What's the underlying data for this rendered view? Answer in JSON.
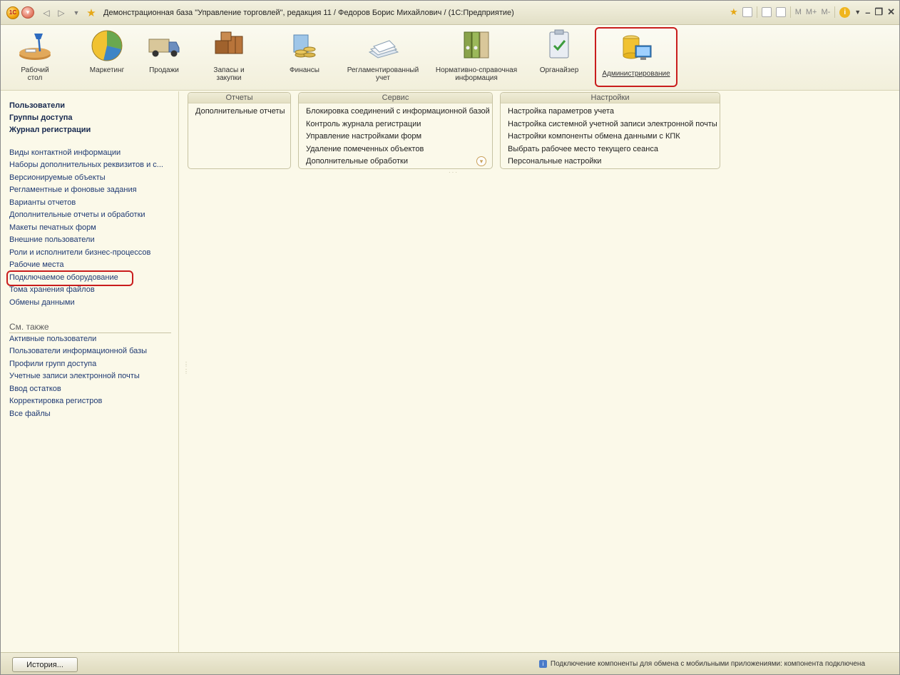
{
  "window": {
    "title": "Демонстрационная база \"Управление торговлей\", редакция 11 / Федоров Борис Михайлович / (1С:Предприятие)",
    "logo_text": "1С",
    "right_controls": [
      "M",
      "M+",
      "M-"
    ]
  },
  "sections": [
    {
      "id": "desktop",
      "label1": "Рабочий",
      "label2": "стол",
      "icon": "desk-lamp-icon"
    },
    {
      "id": "marketing",
      "label1": "Маркетинг",
      "label2": "",
      "icon": "pie-chart-icon"
    },
    {
      "id": "sales",
      "label1": "Продажи",
      "label2": "",
      "icon": "truck-icon"
    },
    {
      "id": "stock",
      "label1": "Запасы и",
      "label2": "закупки",
      "icon": "boxes-icon"
    },
    {
      "id": "finance",
      "label1": "Финансы",
      "label2": "",
      "icon": "coins-icon"
    },
    {
      "id": "regulated",
      "label1": "Регламентированный",
      "label2": "учет",
      "icon": "documents-icon"
    },
    {
      "id": "reference",
      "label1": "Нормативно-справочная",
      "label2": "информация",
      "icon": "binders-icon"
    },
    {
      "id": "organizer",
      "label1": "Органайзер",
      "label2": "",
      "icon": "clipboard-icon"
    },
    {
      "id": "admin",
      "label1": "Администрирование",
      "label2": "",
      "icon": "database-monitor-icon"
    }
  ],
  "nav": {
    "bold_items": [
      "Пользователи",
      "Группы доступа",
      "Журнал регистрации"
    ],
    "items": [
      "Виды контактной информации",
      "Наборы дополнительных реквизитов и с...",
      "Версионируемые объекты",
      "Регламентные и фоновые задания",
      "Варианты отчетов",
      "Дополнительные отчеты и обработки",
      "Макеты печатных форм",
      "Внешние пользователи",
      "Роли и исполнители бизнес-процессов",
      "Рабочие места",
      "Подключаемое оборудование",
      "Тома хранения файлов",
      "Обмены данными"
    ],
    "see_also_title": "См. также",
    "see_also": [
      "Активные пользователи",
      "Пользователи информационной базы",
      "Профили групп доступа",
      "Учетные записи электронной почты",
      "Ввод остатков",
      "Корректировка регистров",
      "Все файлы"
    ]
  },
  "groups": {
    "reports": {
      "title": "Отчеты",
      "items": [
        "Дополнительные отчеты"
      ]
    },
    "service": {
      "title": "Сервис",
      "items": [
        "Блокировка соединений с информационной базой",
        "Контроль журнала регистрации",
        "Управление настройками форм",
        "Удаление помеченных объектов",
        "Дополнительные обработки"
      ]
    },
    "settings": {
      "title": "Настройки",
      "items": [
        "Настройка параметров учета",
        "Настройка системной учетной записи электронной почты",
        "Настройки компоненты обмена данными с КПК",
        "Выбрать рабочее место текущего сеанса",
        "Персональные настройки"
      ]
    }
  },
  "status": {
    "history_label": "История...",
    "message": "Подключение компоненты для обмена с мобильными приложениями: компонента подключена"
  }
}
